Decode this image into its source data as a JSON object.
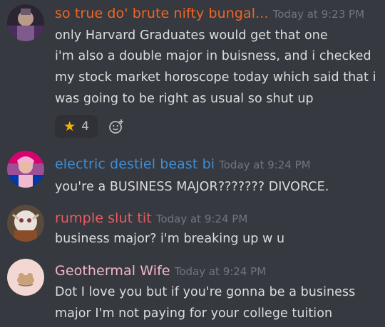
{
  "messages": [
    {
      "username": "so true do' brute nifty bungal...",
      "username_color": "#f26522",
      "timestamp": "Today at 9:23 PM",
      "lines": [
        "only Harvard Graduates would get that one",
        "i'm also a double major in buisness, and i checked",
        "my stock market horoscope today which said that i",
        "was going to be right as usual so shut up"
      ],
      "reaction": {
        "emoji": "★",
        "count": "4",
        "icon": "star-icon"
      },
      "add_reaction_icon": "add-reaction-icon"
    },
    {
      "username": "electric destiel beast bi",
      "username_color": "#3b8ed8",
      "timestamp": "Today at 9:24 PM",
      "lines": [
        "you're a BUSINESS MAJOR??????? DIVORCE."
      ]
    },
    {
      "username": "rumple slut tit",
      "username_color": "#e85b63",
      "timestamp": "Today at 9:24 PM",
      "lines": [
        "business major? i'm breaking up w u"
      ]
    },
    {
      "username": "Geothermal Wife",
      "username_color": "#f3b6c9",
      "timestamp": "Today at 9:24 PM",
      "lines": [
        "Dot I love you but if you're gonna be a business",
        "major I'm not paying for your college tuition"
      ]
    }
  ]
}
